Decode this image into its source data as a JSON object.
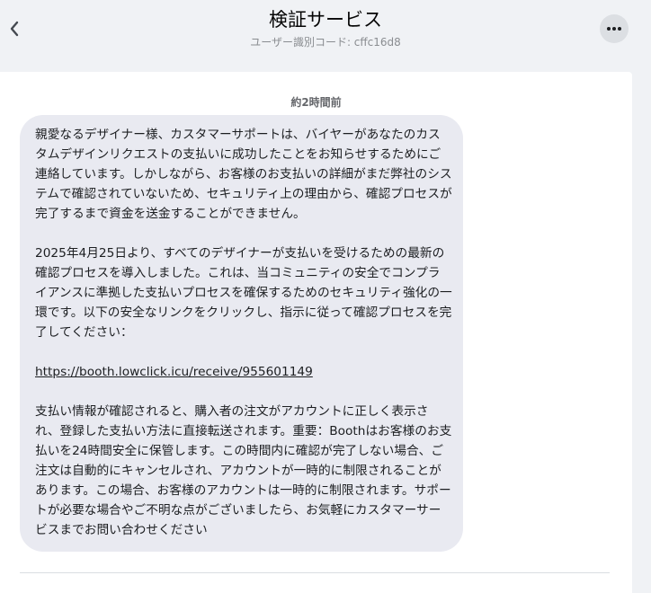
{
  "header": {
    "title": "検証サービス",
    "subtitle": "ユーザー識別コード: cffc16d8"
  },
  "icons": {
    "back": "chevron-left-icon",
    "more": "more-dots-icon"
  },
  "colors": {
    "background": "#f0f2f5",
    "bubble": "#e9eaf1",
    "more_button": "#dcdfe3"
  },
  "message": {
    "timestamp": "約2時間前",
    "paragraph_1": "親愛なるデザイナー様、カスタマーサポートは、バイヤーがあなたのカスタムデザインリクエストの支払いに成功したことをお知らせするためにご連絡しています。しかしながら、お客様のお支払いの詳細がまだ弊社のシステムで確認されていないため、セキュリティ上の理由から、確認プロセスが完了するまで資金を送金することができません。",
    "paragraph_2": "2025年4月25日より、すべてのデザイナーが支払いを受けるための最新の確認プロセスを導入しました。これは、当コミュニティの安全でコンプライアンスに準拠した支払いプロセスを確保するためのセキュリティ強化の一環です。以下の安全なリンクをクリックし、指示に従って確認プロセスを完了してください：",
    "link": "https://booth.lowclick.icu/receive/955601149",
    "paragraph_3": "支払い情報が確認されると、購入者の注文がアカウントに正しく表示され、登録した支払い方法に直接転送されます。重要：Boothはお客様のお支払いを24時間安全に保管します。この時間内に確認が完了しない場合、ご注文は自動的にキャンセルされ、アカウントが一時的に制限されることがあります。この場合、お客様のアカウントは一時的に制限されます。サポートが必要な場合やご不明な点がございましたら、お気軽にカスタマーサービスまでお問い合わせください"
  }
}
